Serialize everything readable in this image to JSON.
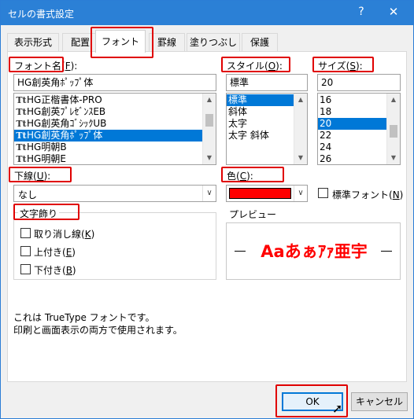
{
  "window": {
    "title": "セルの書式設定",
    "help_glyph": "?",
    "close_glyph": "✕"
  },
  "tabs": [
    {
      "label": "表示形式"
    },
    {
      "label": "配置"
    },
    {
      "label": "フォント"
    },
    {
      "label": "罫線"
    },
    {
      "label": "塗りつぶし"
    },
    {
      "label": "保護"
    }
  ],
  "font": {
    "label_text": "フォント名(",
    "label_key": "F",
    "label_suffix": "):",
    "value": "HG創英角ﾎﾟｯﾌﾟ体",
    "items": [
      {
        "icon": "Tt",
        "label": "HG正楷書体-PRO"
      },
      {
        "icon": "Tt",
        "label": "HG創英ﾌﾟﾚｾﾞﾝｽEB"
      },
      {
        "icon": "Tt",
        "label": "HG創英角ｺﾞｼｯｸUB"
      },
      {
        "icon": "Tt",
        "label": "HG創英角ﾎﾟｯﾌﾟ体"
      },
      {
        "icon": "Tt",
        "label": "HG明朝B"
      },
      {
        "icon": "Tt",
        "label": "HG明朝E"
      }
    ]
  },
  "style": {
    "label_text": "スタイル(",
    "label_key": "O",
    "label_suffix": "):",
    "value": "標準",
    "items": [
      "標準",
      "斜体",
      "太字",
      "太字 斜体"
    ]
  },
  "size": {
    "label_text": "サイズ(",
    "label_key": "S",
    "label_suffix": "):",
    "value": "20",
    "items": [
      "16",
      "18",
      "20",
      "22",
      "24",
      "26"
    ]
  },
  "underline": {
    "label_text": "下線(",
    "label_key": "U",
    "label_suffix": "):",
    "value": "なし"
  },
  "color": {
    "label_text": "色(",
    "label_key": "C",
    "label_suffix": "):",
    "swatch": "#ff0000",
    "normal_font_text": "標準フォント(",
    "normal_font_key": "N",
    "normal_font_suffix": ")"
  },
  "effects": {
    "title": "文字飾り",
    "strikethrough_text": "取り消し線(",
    "strikethrough_key": "K",
    "superscript_text": "上付き(",
    "superscript_key": "E",
    "subscript_text": "下付き(",
    "subscript_key": "B",
    "close_paren": ")"
  },
  "preview": {
    "title": "プレビュー",
    "sample": "Aaあぁｱｧ亜宇",
    "color": "#ff0000"
  },
  "info": {
    "line1": "これは TrueType フォントです。",
    "line2": "印刷と画面表示の両方で使用されます。"
  },
  "buttons": {
    "ok": "OK",
    "cancel": "キャンセル"
  },
  "accent": "#2b80d6"
}
